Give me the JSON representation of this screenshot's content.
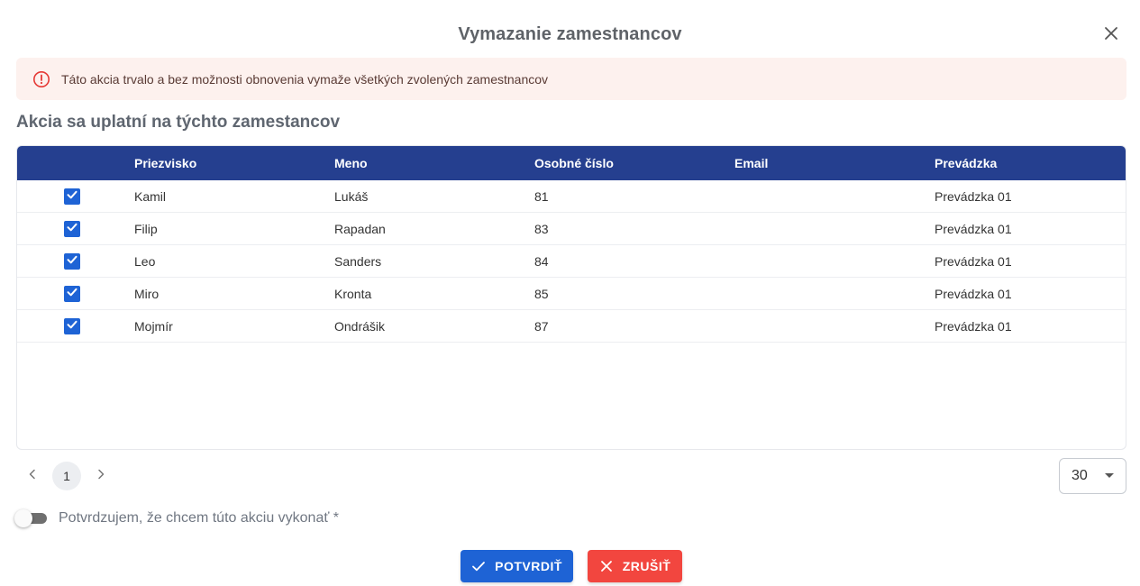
{
  "dialog": {
    "title": "Vymazanie zamestnancov"
  },
  "alert": {
    "icon": "alert-circle-icon",
    "text": "Táto akcia trvalo a bez možnosti obnovenia vymaže všetkých zvolených zamestnancov",
    "color": "#e53935",
    "background": "#fdf1ee"
  },
  "section": {
    "title": "Akcia sa uplatní na týchto zamestancov"
  },
  "table": {
    "header_color": "#253f8f",
    "columns": [
      "Priezvisko",
      "Meno",
      "Osobné číslo",
      "Email",
      "Prevádzka"
    ],
    "rows": [
      {
        "checked": true,
        "surname": "Kamil",
        "name": "Lukáš",
        "number": "81",
        "email": "",
        "shop": "Prevádzka 01"
      },
      {
        "checked": true,
        "surname": "Filip",
        "name": "Rapadan",
        "number": "83",
        "email": "",
        "shop": "Prevádzka 01"
      },
      {
        "checked": true,
        "surname": "Leo",
        "name": "Sanders",
        "number": "84",
        "email": "",
        "shop": "Prevádzka 01"
      },
      {
        "checked": true,
        "surname": "Miro",
        "name": "Kronta",
        "number": "85",
        "email": "",
        "shop": "Prevádzka 01"
      },
      {
        "checked": true,
        "surname": "Mojmír",
        "name": "Ondrášik",
        "number": "87",
        "email": "",
        "shop": "Prevádzka 01"
      }
    ]
  },
  "pagination": {
    "current_page": "1",
    "page_size": "30"
  },
  "confirm": {
    "label": "Potvrdzujem, že chcem túto akciu vykonať *",
    "toggled": false
  },
  "buttons": {
    "confirm_label": "POTVRDIŤ",
    "confirm_color": "#1e63d5",
    "cancel_label": "ZRUŠIŤ",
    "cancel_color": "#f2463f"
  }
}
